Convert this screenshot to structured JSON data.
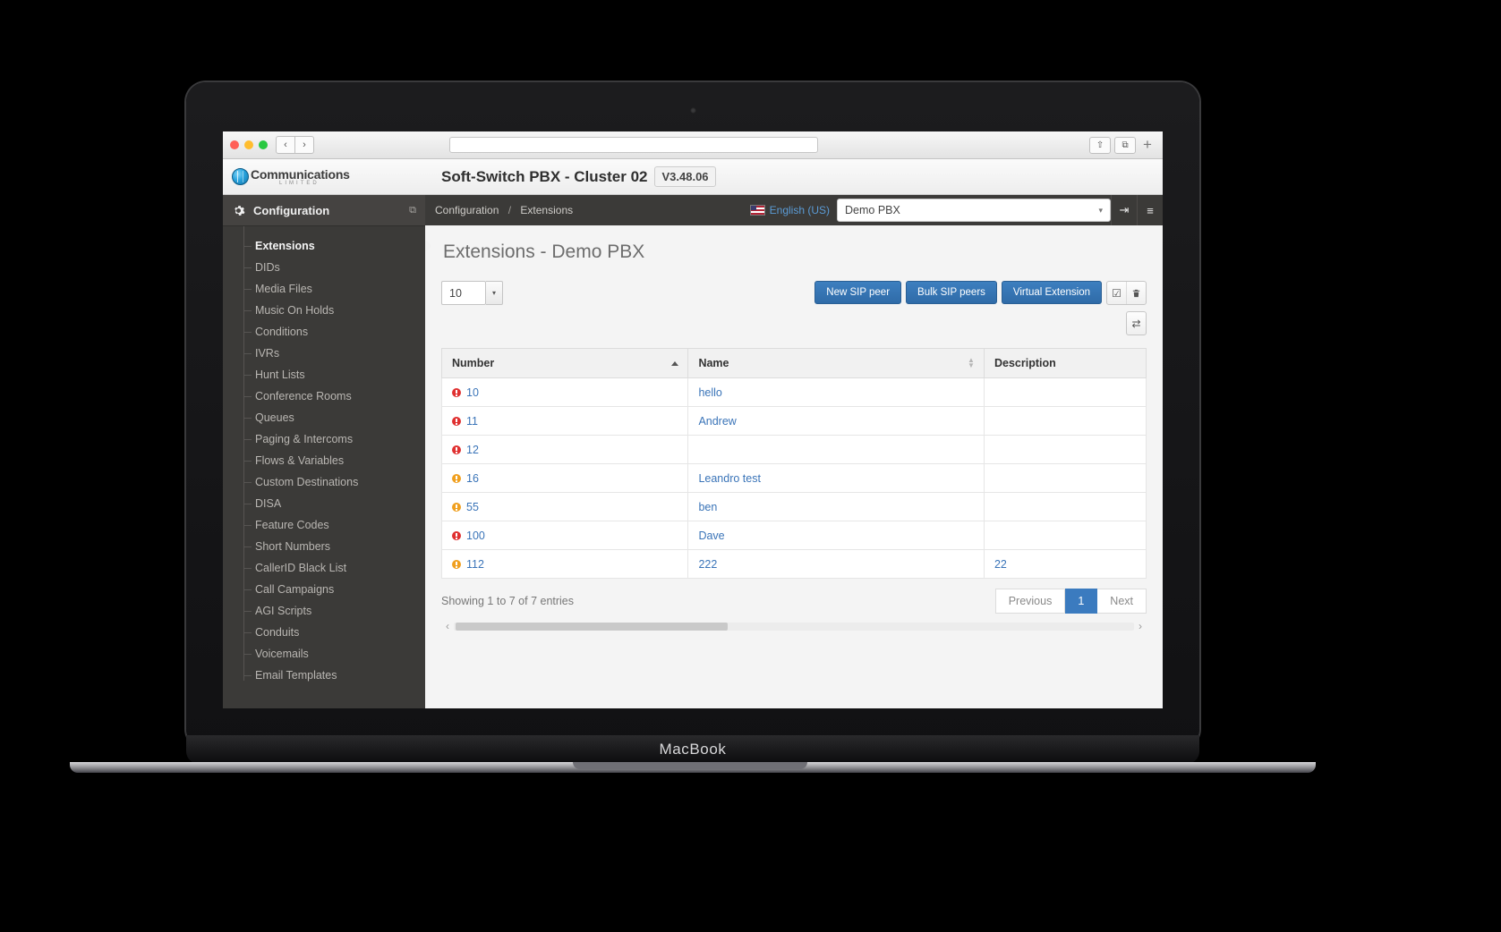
{
  "browser": {
    "traffic_lights": [
      "close",
      "minimize",
      "zoom"
    ],
    "back_label": "‹",
    "forward_label": "›",
    "url_value": "",
    "url_placeholder": "",
    "share_label": "⇧",
    "tabs_label": "⧉",
    "new_tab_label": "+"
  },
  "header": {
    "logo_text": "Communications",
    "logo_subtext": "LIMITED",
    "title": "Soft-Switch PBX - Cluster 02",
    "version": "V3.48.06"
  },
  "sidebar": {
    "section_title": "Configuration",
    "collapse_label": "⧉",
    "items": [
      {
        "label": "Extensions",
        "active": true
      },
      {
        "label": "DIDs",
        "active": false
      },
      {
        "label": "Media Files",
        "active": false
      },
      {
        "label": "Music On Holds",
        "active": false
      },
      {
        "label": "Conditions",
        "active": false
      },
      {
        "label": "IVRs",
        "active": false
      },
      {
        "label": "Hunt Lists",
        "active": false
      },
      {
        "label": "Conference Rooms",
        "active": false
      },
      {
        "label": "Queues",
        "active": false
      },
      {
        "label": "Paging & Intercoms",
        "active": false
      },
      {
        "label": "Flows & Variables",
        "active": false
      },
      {
        "label": "Custom Destinations",
        "active": false
      },
      {
        "label": "DISA",
        "active": false
      },
      {
        "label": "Feature Codes",
        "active": false
      },
      {
        "label": "Short Numbers",
        "active": false
      },
      {
        "label": "CallerID Black List",
        "active": false
      },
      {
        "label": "Call Campaigns",
        "active": false
      },
      {
        "label": "AGI Scripts",
        "active": false
      },
      {
        "label": "Conduits",
        "active": false
      },
      {
        "label": "Voicemails",
        "active": false
      },
      {
        "label": "Email Templates",
        "active": false
      }
    ]
  },
  "topbar": {
    "breadcrumb_root": "Configuration",
    "breadcrumb_sep": "/",
    "breadcrumb_current": "Extensions",
    "language": "English (US)",
    "pbx_selected": "Demo PBX",
    "pbx_caret": "▾",
    "logout_label": "⇥",
    "menu_label": "≡"
  },
  "page": {
    "title": "Extensions - Demo PBX",
    "page_length": "10",
    "page_length_caret": "▾",
    "buttons": {
      "new_sip_peer": "New SIP peer",
      "bulk_sip_peers": "Bulk SIP peers",
      "virtual_extension": "Virtual Extension",
      "select_all_label": "☑",
      "delete_label": "Ὕ1",
      "columns_label": "⇄"
    }
  },
  "table": {
    "columns": [
      {
        "label": "Number",
        "sort": "asc"
      },
      {
        "label": "Name",
        "sort": "none"
      },
      {
        "label": "Description",
        "sort": "none"
      }
    ],
    "rows": [
      {
        "status": "offline",
        "number": "10",
        "name": "hello",
        "description": ""
      },
      {
        "status": "offline",
        "number": "11",
        "name": "Andrew",
        "description": ""
      },
      {
        "status": "offline",
        "number": "12",
        "name": "",
        "description": ""
      },
      {
        "status": "warning",
        "number": "16",
        "name": "Leandro test",
        "description": ""
      },
      {
        "status": "warning",
        "number": "55",
        "name": "ben",
        "description": ""
      },
      {
        "status": "offline",
        "number": "100",
        "name": "Dave",
        "description": ""
      },
      {
        "status": "warning",
        "number": "112",
        "name": "222",
        "description": "22"
      }
    ],
    "footer": {
      "showing": "Showing 1 to 7 of 7 entries",
      "previous": "Previous",
      "current_page": "1",
      "next": "Next"
    },
    "scroll": {
      "left_arrow": "‹",
      "right_arrow": "›"
    }
  },
  "laptop": {
    "brand": "MacBook"
  },
  "colors": {
    "accent": "#3b7bbf",
    "sidebar_bg": "#3b3a38",
    "status_offline": "#e03131",
    "status_warning": "#f0a020",
    "link": "#3a74b8"
  }
}
